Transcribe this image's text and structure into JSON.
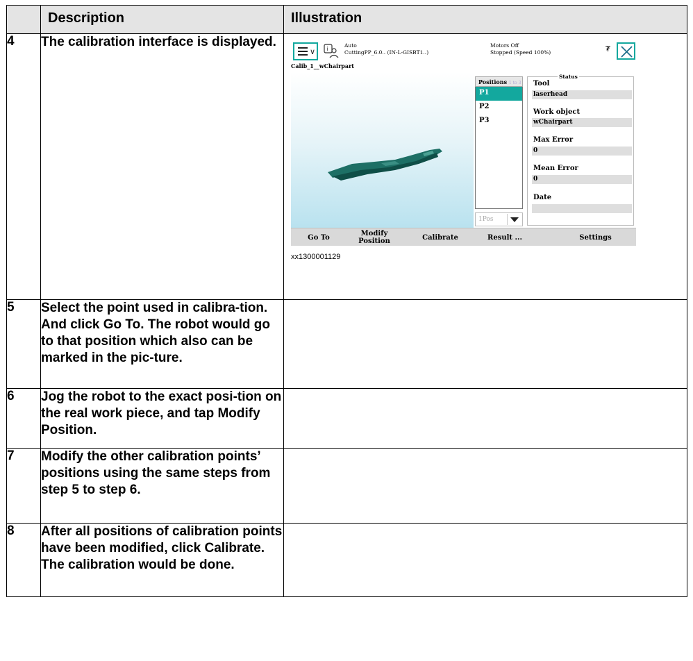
{
  "table": {
    "headers": [
      "",
      "Description",
      "Illustration"
    ],
    "rows": [
      {
        "num": "4",
        "desc": "The calibration interface is displayed."
      },
      {
        "num": "5",
        "desc": ""
      },
      {
        "num": "6",
        "desc": ""
      },
      {
        "num": "7",
        "desc": "Modify the other calibration points’ positions using the same steps from step 5 to step 6."
      },
      {
        "num": "8",
        "desc": ""
      }
    ],
    "row5": {
      "a": "Select the point used in calibra-tion. And click ",
      "b": "Go To",
      "c": ". The robot would go to that position which also can be marked in the pic-ture."
    },
    "row6": {
      "a": "Jog the robot to the exact posi-tion on the real work piece, and tap ",
      "b": "Modify Position",
      "c": "."
    },
    "row8": {
      "a": "After all positions of calibration points have been modified, click ",
      "b": "Calibrate",
      "c": ". The calibration would be done."
    }
  },
  "pendant": {
    "status_line1_a": "Auto",
    "status_line2_a": "CuttingPP_6.0.. (IN-L-GISBT1..)",
    "status_line1_b": "Motors Off",
    "status_line2_b": "Stopped (Speed 100%)",
    "program_title": "Calib_1__wChairpart",
    "positions_header": "Positions",
    "positions_count": "1 to 3 of 3",
    "positions": [
      "P1",
      "P2",
      "P3"
    ],
    "combo_value": "1Pos",
    "status_legend": "Status",
    "status_fields": [
      {
        "label": "Tool",
        "value": "laserhead"
      },
      {
        "label": "Work object",
        "value": "wChairpart"
      },
      {
        "label": "Max Error",
        "value": "0"
      },
      {
        "label": "Mean Error",
        "value": "0"
      },
      {
        "label": "Date",
        "value": ""
      }
    ],
    "buttons": {
      "goto": "Go To",
      "modify1": "Modify",
      "modify2": "Position",
      "calibrate": "Calibrate",
      "result": "Result ...",
      "settings": "Settings"
    }
  },
  "caption": "xx1300001129"
}
